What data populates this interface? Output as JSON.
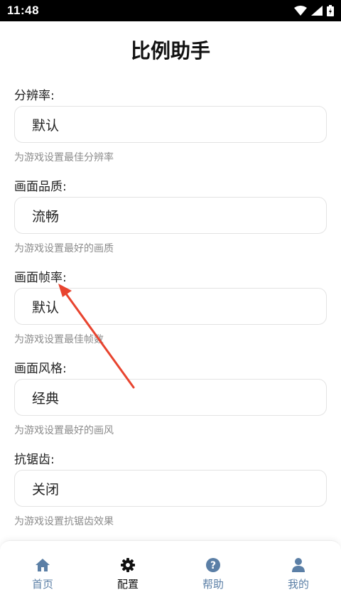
{
  "status_bar": {
    "time": "11:48"
  },
  "page": {
    "title": "比例助手"
  },
  "fields": [
    {
      "label": "分辨率:",
      "value": "默认",
      "hint": "为游戏设置最佳分辨率"
    },
    {
      "label": "画面品质:",
      "value": "流畅",
      "hint": "为游戏设置最好的画质"
    },
    {
      "label": "画面帧率:",
      "value": "默认",
      "hint": "为游戏设置最佳帧数"
    },
    {
      "label": "画面风格:",
      "value": "经典",
      "hint": "为游戏设置最好的画风"
    },
    {
      "label": "抗锯齿:",
      "value": "关闭",
      "hint": "为游戏设置抗锯齿效果"
    }
  ],
  "tab_bar": {
    "tabs": [
      {
        "label": "首页",
        "icon": "home-icon",
        "active": false
      },
      {
        "label": "配置",
        "icon": "gear-icon",
        "active": true
      },
      {
        "label": "帮助",
        "icon": "help-icon",
        "active": false
      },
      {
        "label": "我的",
        "icon": "user-icon",
        "active": false
      }
    ]
  },
  "colors": {
    "inactive_tab": "#5b7fa6",
    "active_tab": "#111111",
    "annotation_arrow": "#e8442f"
  }
}
